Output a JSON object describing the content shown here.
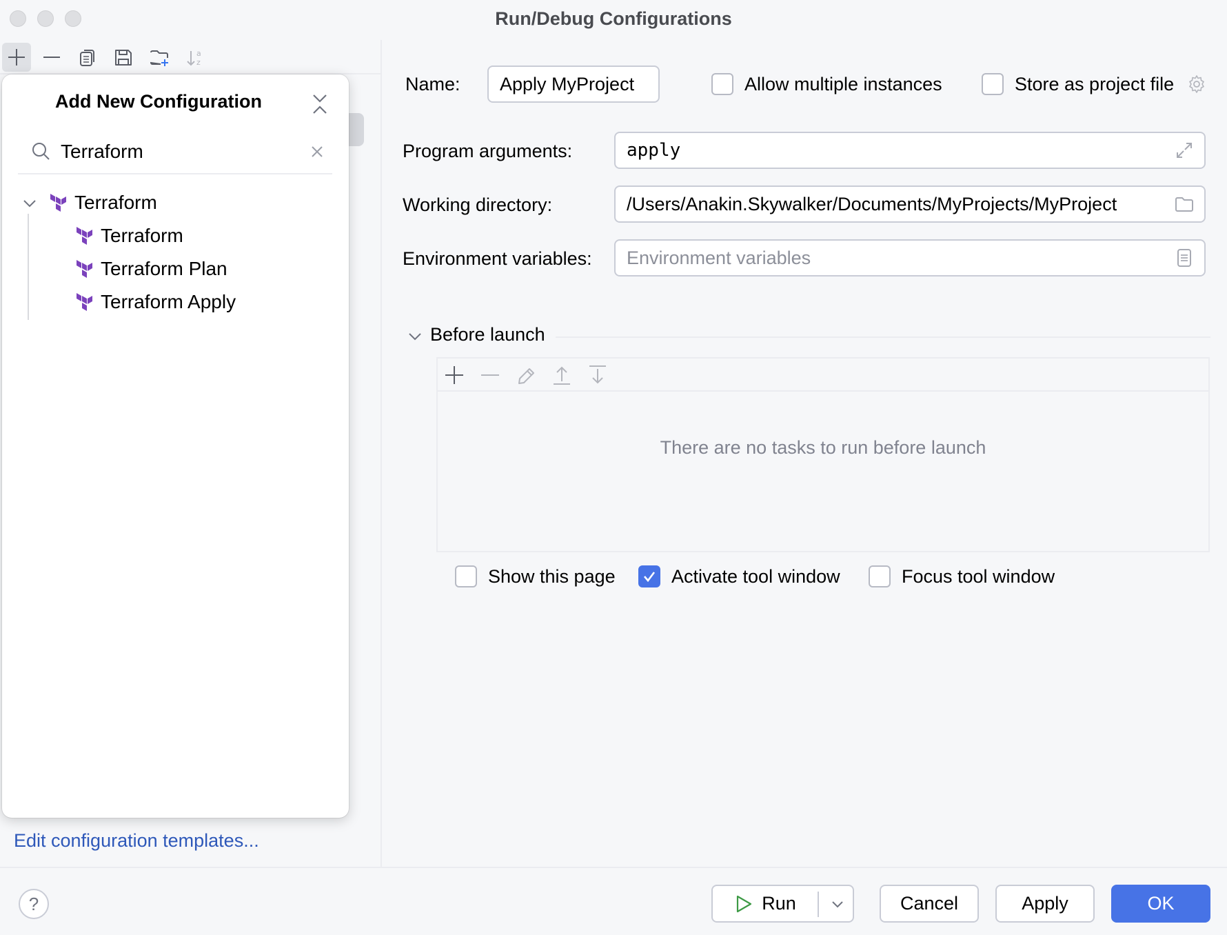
{
  "window": {
    "title": "Run/Debug Configurations",
    "traffic_lights": [
      "close",
      "minimize",
      "zoom"
    ]
  },
  "left_toolbar": {
    "icons": [
      {
        "name": "add-icon",
        "tooltip": "Add New Configuration",
        "active": true
      },
      {
        "name": "remove-icon",
        "active": false
      },
      {
        "name": "copy-icon",
        "active": false
      },
      {
        "name": "save-icon",
        "active": false
      },
      {
        "name": "new-folder-icon",
        "active": false
      },
      {
        "name": "sort-alphabetically-icon",
        "active": false
      }
    ]
  },
  "popup": {
    "title": "Add New Configuration",
    "search": {
      "value": "Terraform",
      "placeholder": ""
    },
    "tree": {
      "group": {
        "label": "Terraform",
        "expanded": true,
        "icon": "terraform-icon"
      },
      "children": [
        {
          "label": "Terraform",
          "icon": "terraform-icon"
        },
        {
          "label": "Terraform Plan",
          "icon": "terraform-icon"
        },
        {
          "label": "Terraform Apply",
          "icon": "terraform-icon"
        }
      ]
    }
  },
  "edit_templates_link": "Edit configuration templates...",
  "form": {
    "name_label": "Name:",
    "name_value": "Apply MyProject",
    "allow_multiple": {
      "label": "Allow multiple instances",
      "checked": false
    },
    "store_project": {
      "label": "Store as project file",
      "checked": false
    },
    "program_arguments": {
      "label": "Program arguments:",
      "value": "apply"
    },
    "working_directory": {
      "label": "Working directory:",
      "value": "/Users/Anakin.Skywalker/Documents/MyProjects/MyProject"
    },
    "environment_variables": {
      "label": "Environment variables:",
      "value": "",
      "placeholder": "Environment variables"
    }
  },
  "before_launch": {
    "title": "Before launch",
    "expanded": true,
    "toolbar": [
      "add-icon",
      "remove-icon",
      "edit-icon",
      "move-up-icon",
      "move-down-icon"
    ],
    "empty_text": "There are no tasks to run before launch",
    "options": [
      {
        "label": "Show this page",
        "checked": false
      },
      {
        "label": "Activate tool window",
        "checked": true
      },
      {
        "label": "Focus tool window",
        "checked": false
      }
    ]
  },
  "footer": {
    "help": "?",
    "run": "Run",
    "cancel": "Cancel",
    "apply": "Apply",
    "ok": "OK"
  },
  "colors": {
    "accent": "#4773e6",
    "link": "#2e58b9",
    "terraform": "#7b42bc",
    "run_icon": "#3d9a45"
  }
}
